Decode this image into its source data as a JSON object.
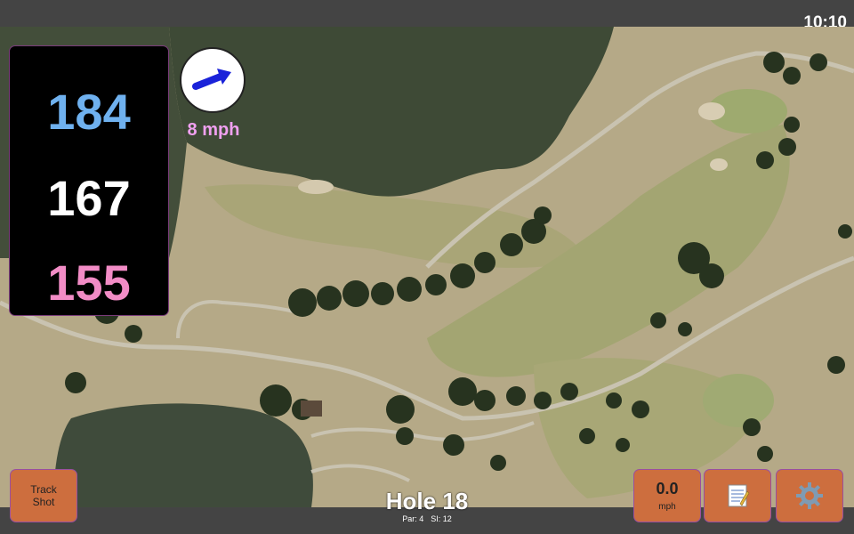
{
  "status_bar": {
    "time": "10:10"
  },
  "distances": {
    "back": "184",
    "middle": "167",
    "front": "155",
    "colors": {
      "back": "#6fb1ef",
      "middle": "#ffffff",
      "front": "#f28cc6"
    }
  },
  "wind": {
    "speed": "8 mph",
    "arrow_icon": "arrow-right-icon"
  },
  "hole": {
    "title": "Hole 18",
    "par": "Par: 4",
    "si": "SI: 12"
  },
  "buttons": {
    "track_shot": "Track Shot",
    "speed_value": "0.0",
    "speed_unit": "mph",
    "notes_icon": "memo-icon",
    "settings_icon": "gear-icon"
  },
  "colors": {
    "button_bg": "#cd6e3e",
    "button_border": "#9a4fa0",
    "panel_bg": "#000000"
  }
}
